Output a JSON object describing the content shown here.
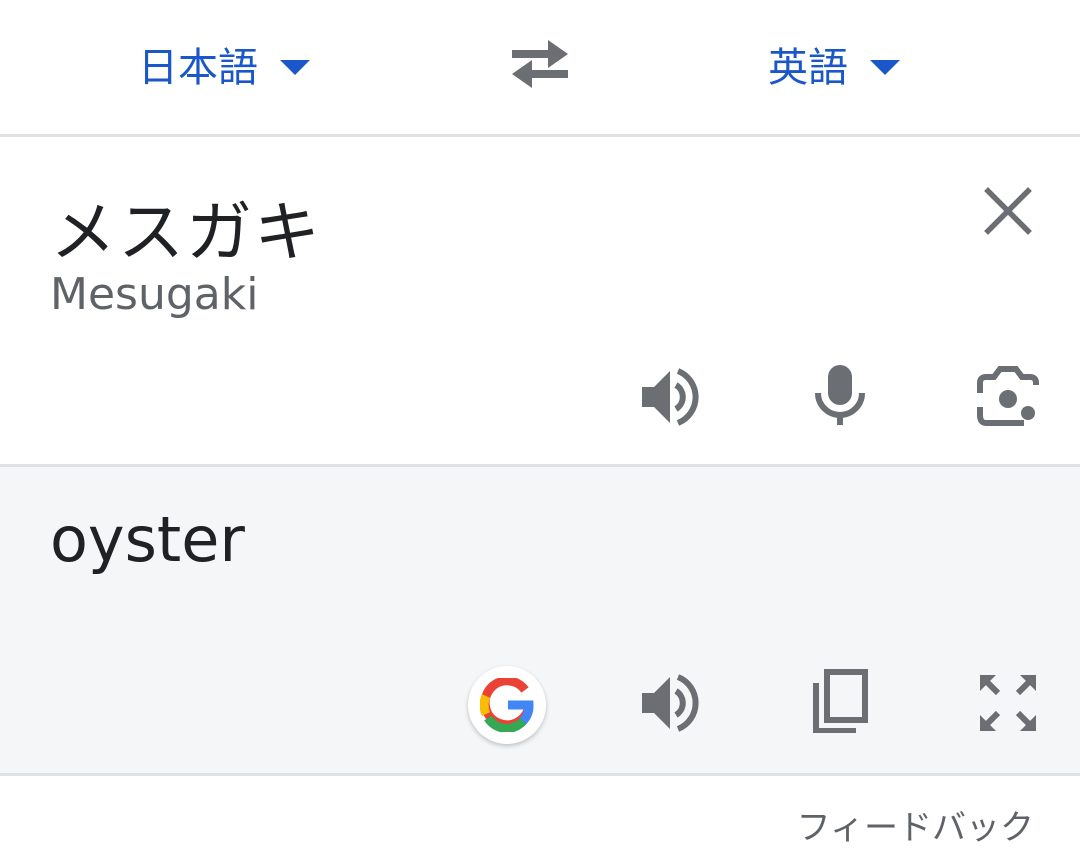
{
  "languages": {
    "source": "日本語",
    "target": "英語"
  },
  "input": {
    "text": "メスガキ",
    "romanization": "Mesugaki"
  },
  "output": {
    "text": "oyster"
  },
  "footer": {
    "feedback_label": "フィードバック"
  },
  "icons": {
    "source_dropdown": "caret-down-icon",
    "swap": "swap-arrows-icon",
    "target_dropdown": "caret-down-icon",
    "clear": "close-icon",
    "source_speak": "speaker-icon",
    "mic": "microphone-icon",
    "camera": "camera-icon",
    "google": "google-logo-icon",
    "result_speak": "speaker-icon",
    "copy": "copy-icon",
    "fullscreen": "fullscreen-icon"
  },
  "colors": {
    "accent": "#1a57c8",
    "icon_gray": "#6b6e72",
    "result_background": "#f5f6f8",
    "divider": "#dfe1e5"
  }
}
